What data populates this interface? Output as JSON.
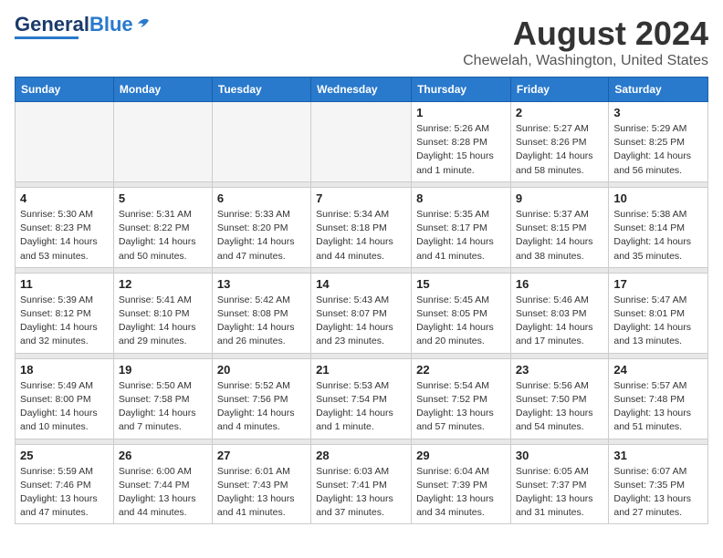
{
  "logo": {
    "general": "General",
    "blue": "Blue"
  },
  "header": {
    "month": "August 2024",
    "location": "Chewelah, Washington, United States"
  },
  "weekdays": [
    "Sunday",
    "Monday",
    "Tuesday",
    "Wednesday",
    "Thursday",
    "Friday",
    "Saturday"
  ],
  "weeks": [
    [
      {
        "day": "",
        "sunrise": "",
        "sunset": "",
        "daylight": "",
        "empty": true
      },
      {
        "day": "",
        "sunrise": "",
        "sunset": "",
        "daylight": "",
        "empty": true
      },
      {
        "day": "",
        "sunrise": "",
        "sunset": "",
        "daylight": "",
        "empty": true
      },
      {
        "day": "",
        "sunrise": "",
        "sunset": "",
        "daylight": "",
        "empty": true
      },
      {
        "day": "1",
        "sunrise": "Sunrise: 5:26 AM",
        "sunset": "Sunset: 8:28 PM",
        "daylight": "Daylight: 15 hours and 1 minute."
      },
      {
        "day": "2",
        "sunrise": "Sunrise: 5:27 AM",
        "sunset": "Sunset: 8:26 PM",
        "daylight": "Daylight: 14 hours and 58 minutes."
      },
      {
        "day": "3",
        "sunrise": "Sunrise: 5:29 AM",
        "sunset": "Sunset: 8:25 PM",
        "daylight": "Daylight: 14 hours and 56 minutes."
      }
    ],
    [
      {
        "day": "4",
        "sunrise": "Sunrise: 5:30 AM",
        "sunset": "Sunset: 8:23 PM",
        "daylight": "Daylight: 14 hours and 53 minutes."
      },
      {
        "day": "5",
        "sunrise": "Sunrise: 5:31 AM",
        "sunset": "Sunset: 8:22 PM",
        "daylight": "Daylight: 14 hours and 50 minutes."
      },
      {
        "day": "6",
        "sunrise": "Sunrise: 5:33 AM",
        "sunset": "Sunset: 8:20 PM",
        "daylight": "Daylight: 14 hours and 47 minutes."
      },
      {
        "day": "7",
        "sunrise": "Sunrise: 5:34 AM",
        "sunset": "Sunset: 8:18 PM",
        "daylight": "Daylight: 14 hours and 44 minutes."
      },
      {
        "day": "8",
        "sunrise": "Sunrise: 5:35 AM",
        "sunset": "Sunset: 8:17 PM",
        "daylight": "Daylight: 14 hours and 41 minutes."
      },
      {
        "day": "9",
        "sunrise": "Sunrise: 5:37 AM",
        "sunset": "Sunset: 8:15 PM",
        "daylight": "Daylight: 14 hours and 38 minutes."
      },
      {
        "day": "10",
        "sunrise": "Sunrise: 5:38 AM",
        "sunset": "Sunset: 8:14 PM",
        "daylight": "Daylight: 14 hours and 35 minutes."
      }
    ],
    [
      {
        "day": "11",
        "sunrise": "Sunrise: 5:39 AM",
        "sunset": "Sunset: 8:12 PM",
        "daylight": "Daylight: 14 hours and 32 minutes."
      },
      {
        "day": "12",
        "sunrise": "Sunrise: 5:41 AM",
        "sunset": "Sunset: 8:10 PM",
        "daylight": "Daylight: 14 hours and 29 minutes."
      },
      {
        "day": "13",
        "sunrise": "Sunrise: 5:42 AM",
        "sunset": "Sunset: 8:08 PM",
        "daylight": "Daylight: 14 hours and 26 minutes."
      },
      {
        "day": "14",
        "sunrise": "Sunrise: 5:43 AM",
        "sunset": "Sunset: 8:07 PM",
        "daylight": "Daylight: 14 hours and 23 minutes."
      },
      {
        "day": "15",
        "sunrise": "Sunrise: 5:45 AM",
        "sunset": "Sunset: 8:05 PM",
        "daylight": "Daylight: 14 hours and 20 minutes."
      },
      {
        "day": "16",
        "sunrise": "Sunrise: 5:46 AM",
        "sunset": "Sunset: 8:03 PM",
        "daylight": "Daylight: 14 hours and 17 minutes."
      },
      {
        "day": "17",
        "sunrise": "Sunrise: 5:47 AM",
        "sunset": "Sunset: 8:01 PM",
        "daylight": "Daylight: 14 hours and 13 minutes."
      }
    ],
    [
      {
        "day": "18",
        "sunrise": "Sunrise: 5:49 AM",
        "sunset": "Sunset: 8:00 PM",
        "daylight": "Daylight: 14 hours and 10 minutes."
      },
      {
        "day": "19",
        "sunrise": "Sunrise: 5:50 AM",
        "sunset": "Sunset: 7:58 PM",
        "daylight": "Daylight: 14 hours and 7 minutes."
      },
      {
        "day": "20",
        "sunrise": "Sunrise: 5:52 AM",
        "sunset": "Sunset: 7:56 PM",
        "daylight": "Daylight: 14 hours and 4 minutes."
      },
      {
        "day": "21",
        "sunrise": "Sunrise: 5:53 AM",
        "sunset": "Sunset: 7:54 PM",
        "daylight": "Daylight: 14 hours and 1 minute."
      },
      {
        "day": "22",
        "sunrise": "Sunrise: 5:54 AM",
        "sunset": "Sunset: 7:52 PM",
        "daylight": "Daylight: 13 hours and 57 minutes."
      },
      {
        "day": "23",
        "sunrise": "Sunrise: 5:56 AM",
        "sunset": "Sunset: 7:50 PM",
        "daylight": "Daylight: 13 hours and 54 minutes."
      },
      {
        "day": "24",
        "sunrise": "Sunrise: 5:57 AM",
        "sunset": "Sunset: 7:48 PM",
        "daylight": "Daylight: 13 hours and 51 minutes."
      }
    ],
    [
      {
        "day": "25",
        "sunrise": "Sunrise: 5:59 AM",
        "sunset": "Sunset: 7:46 PM",
        "daylight": "Daylight: 13 hours and 47 minutes."
      },
      {
        "day": "26",
        "sunrise": "Sunrise: 6:00 AM",
        "sunset": "Sunset: 7:44 PM",
        "daylight": "Daylight: 13 hours and 44 minutes."
      },
      {
        "day": "27",
        "sunrise": "Sunrise: 6:01 AM",
        "sunset": "Sunset: 7:43 PM",
        "daylight": "Daylight: 13 hours and 41 minutes."
      },
      {
        "day": "28",
        "sunrise": "Sunrise: 6:03 AM",
        "sunset": "Sunset: 7:41 PM",
        "daylight": "Daylight: 13 hours and 37 minutes."
      },
      {
        "day": "29",
        "sunrise": "Sunrise: 6:04 AM",
        "sunset": "Sunset: 7:39 PM",
        "daylight": "Daylight: 13 hours and 34 minutes."
      },
      {
        "day": "30",
        "sunrise": "Sunrise: 6:05 AM",
        "sunset": "Sunset: 7:37 PM",
        "daylight": "Daylight: 13 hours and 31 minutes."
      },
      {
        "day": "31",
        "sunrise": "Sunrise: 6:07 AM",
        "sunset": "Sunset: 7:35 PM",
        "daylight": "Daylight: 13 hours and 27 minutes."
      }
    ]
  ]
}
